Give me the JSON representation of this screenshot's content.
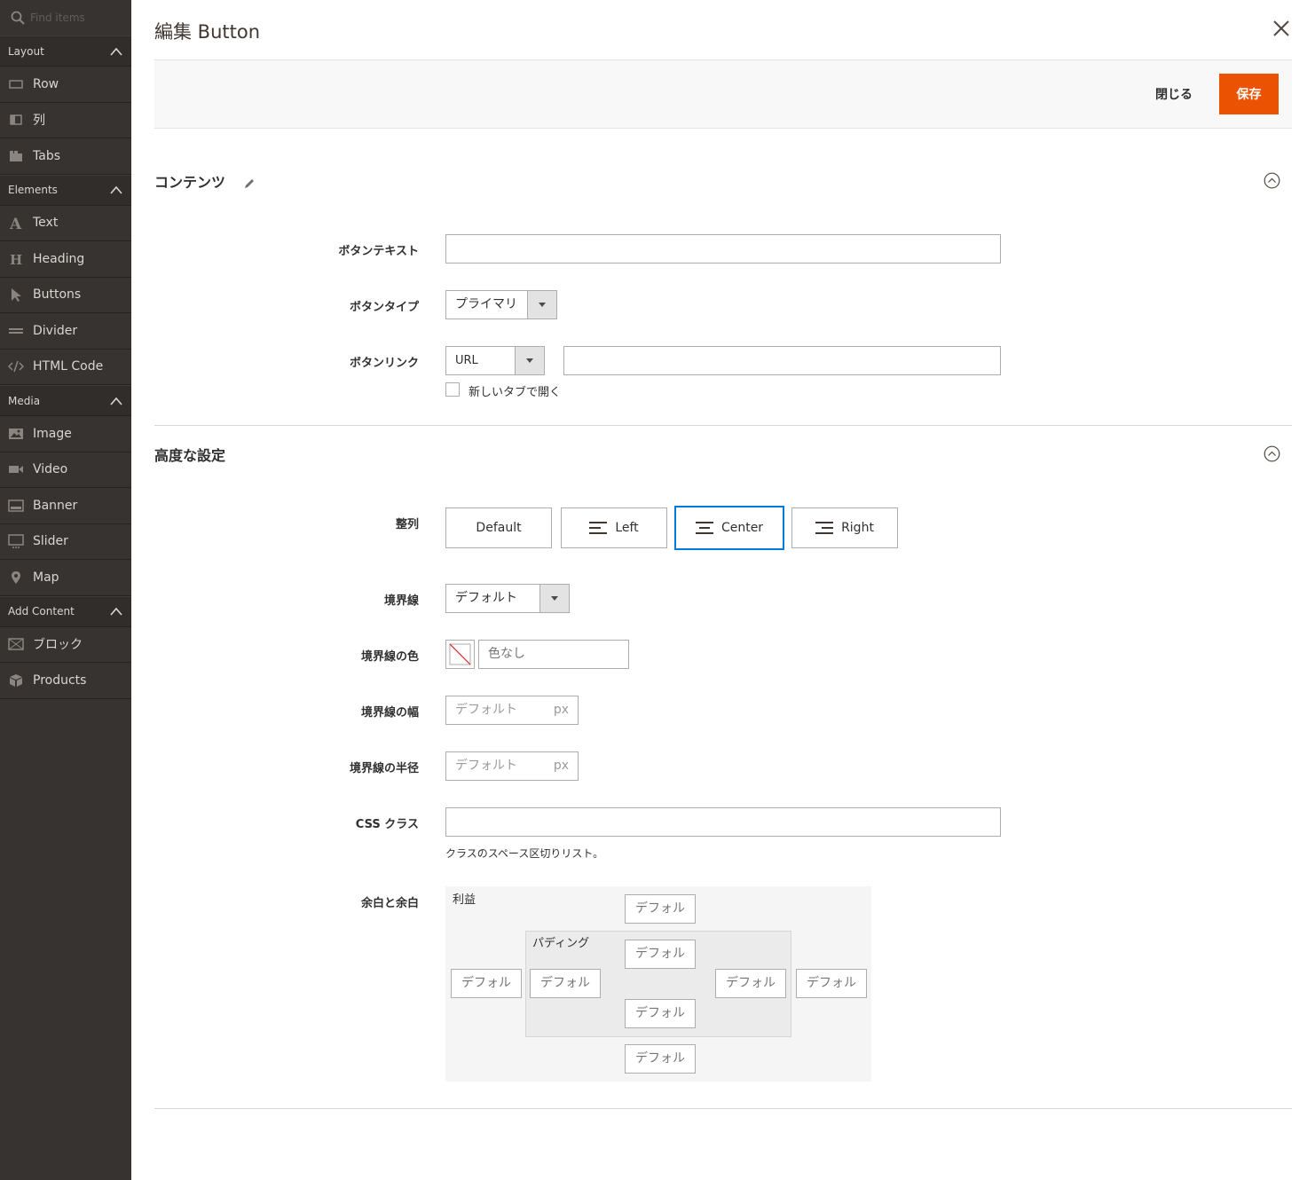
{
  "sidebar": {
    "search_placeholder": "Find items",
    "groups": [
      {
        "label": "Layout",
        "items": [
          {
            "label": "Row",
            "icon": "row-icon"
          },
          {
            "label": "列",
            "icon": "column-icon"
          },
          {
            "label": "Tabs",
            "icon": "tabs-icon"
          }
        ]
      },
      {
        "label": "Elements",
        "items": [
          {
            "label": "Text",
            "icon": "text-icon"
          },
          {
            "label": "Heading",
            "icon": "heading-icon"
          },
          {
            "label": "Buttons",
            "icon": "pointer-icon"
          },
          {
            "label": "Divider",
            "icon": "divider-icon"
          },
          {
            "label": "HTML Code",
            "icon": "code-icon"
          }
        ]
      },
      {
        "label": "Media",
        "items": [
          {
            "label": "Image",
            "icon": "image-icon"
          },
          {
            "label": "Video",
            "icon": "video-icon"
          },
          {
            "label": "Banner",
            "icon": "banner-icon"
          },
          {
            "label": "Slider",
            "icon": "slider-icon"
          },
          {
            "label": "Map",
            "icon": "map-pin-icon"
          }
        ]
      },
      {
        "label": "Add Content",
        "items": [
          {
            "label": "ブロック",
            "icon": "block-icon"
          },
          {
            "label": "Products",
            "icon": "products-icon"
          }
        ]
      }
    ]
  },
  "modal": {
    "title": "編集 Button",
    "close_label": "閉じる",
    "save_label": "保存"
  },
  "content_section": {
    "title": "コンテンツ",
    "button_text_label": "ボタンテキスト",
    "button_text_value": "",
    "button_type_label": "ボタンタイプ",
    "button_type_value": "プライマリ",
    "button_link_label": "ボタンリンク",
    "button_link_type": "URL",
    "button_link_value": "",
    "new_tab_label": "新しいタブで開く"
  },
  "advanced_section": {
    "title": "高度な設定",
    "alignment_label": "整列",
    "alignment_options": [
      "Default",
      "Left",
      "Center",
      "Right"
    ],
    "alignment_selected": "Center",
    "border_label": "境界線",
    "border_value": "デフォルト",
    "border_color_label": "境界線の色",
    "border_color_placeholder": "色なし",
    "border_width_label": "境界線の幅",
    "border_width_placeholder": "デフォルト",
    "border_radius_label": "境界線の半径",
    "border_radius_placeholder": "デフォルト",
    "unit": "px",
    "css_class_label": "CSS クラス",
    "css_class_value": "",
    "css_class_note": "クラスのスペース区切りリスト。",
    "spacing_label": "余白と余白",
    "margin_label": "利益",
    "padding_label": "パディング",
    "default_placeholder": "デフォルル",
    "default_placeholder_short": "デフォル"
  },
  "colors": {
    "accent": "#eb5202",
    "active_border": "#007bdb",
    "sidebar_bg": "#373330"
  }
}
